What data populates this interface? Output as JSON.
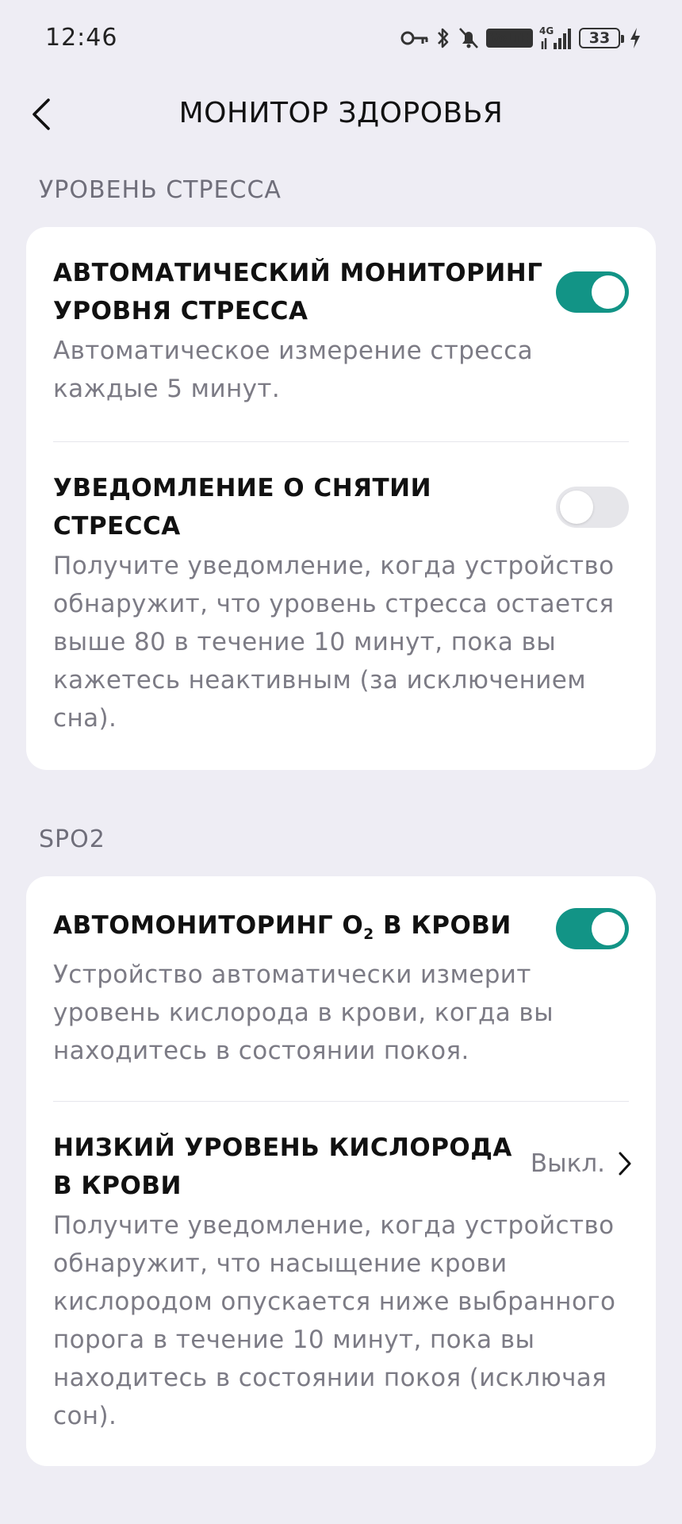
{
  "status_bar": {
    "time": "12:46",
    "icons": [
      "key-icon",
      "bluetooth-icon",
      "bell-muted-icon",
      "volte-icon",
      "signal-4g-icon",
      "battery-icon",
      "charging-icon"
    ],
    "volte_label": "VoLTE",
    "network_label": "4G",
    "battery_level": "33"
  },
  "header": {
    "title": "МОНИТОР ЗДОРОВЬЯ",
    "back_icon": "chevron-left-icon"
  },
  "stress_section": {
    "label": "УРОВЕНЬ СТРЕССА",
    "auto_monitoring": {
      "title_line1": "АВТОМАТИЧЕСКИЙ МОНИТОРИНГ",
      "title_line2": "УРОВНЯ СТРЕССА",
      "desc_line1": "Автоматическое измерение стресса",
      "desc_line2": "каждые 5 минут.",
      "enabled": true
    },
    "relief_notification": {
      "title_line1": "УВЕДОМЛЕНИЕ О СНЯТИИ",
      "title_line2": "СТРЕССА",
      "desc_line1": "Получите уведомление, когда устройство",
      "desc_line2": "обнаружит, что уровень стресса остается",
      "desc_line3": "выше 80 в течение 10 минут, пока вы",
      "desc_line4": "кажетесь неактивным (за исключением",
      "desc_line5": "сна).",
      "enabled": false
    }
  },
  "spo2_section": {
    "label": "SPO2",
    "auto_monitoring": {
      "title_prefix": "АВТОМОНИТОРИНГ O",
      "title_sub": "2",
      "title_suffix": " В КРОВИ",
      "desc_line1": "Устройство автоматически измерит",
      "desc_line2": "уровень кислорода в крови, когда вы",
      "desc_line3": "находитесь в состоянии покоя.",
      "enabled": true
    },
    "low_oxygen": {
      "title_line1": "НИЗКИЙ УРОВЕНЬ КИСЛОРОДА",
      "title_line2": "В КРОВИ",
      "value": "Выкл.",
      "desc_line1": "Получите уведомление, когда устройство",
      "desc_line2": "обнаружит, что насыщение крови",
      "desc_line3": "кислородом опускается ниже выбранного",
      "desc_line4": "порога в течение 10 минут, пока вы",
      "desc_line5": "находитесь в состоянии покоя (исключая",
      "desc_line6": "сон)."
    }
  },
  "colors": {
    "accent": "#129486",
    "background": "#eeedf4",
    "card": "#ffffff",
    "secondary_text": "#7c7b85",
    "section_label": "#6f6e7a"
  }
}
